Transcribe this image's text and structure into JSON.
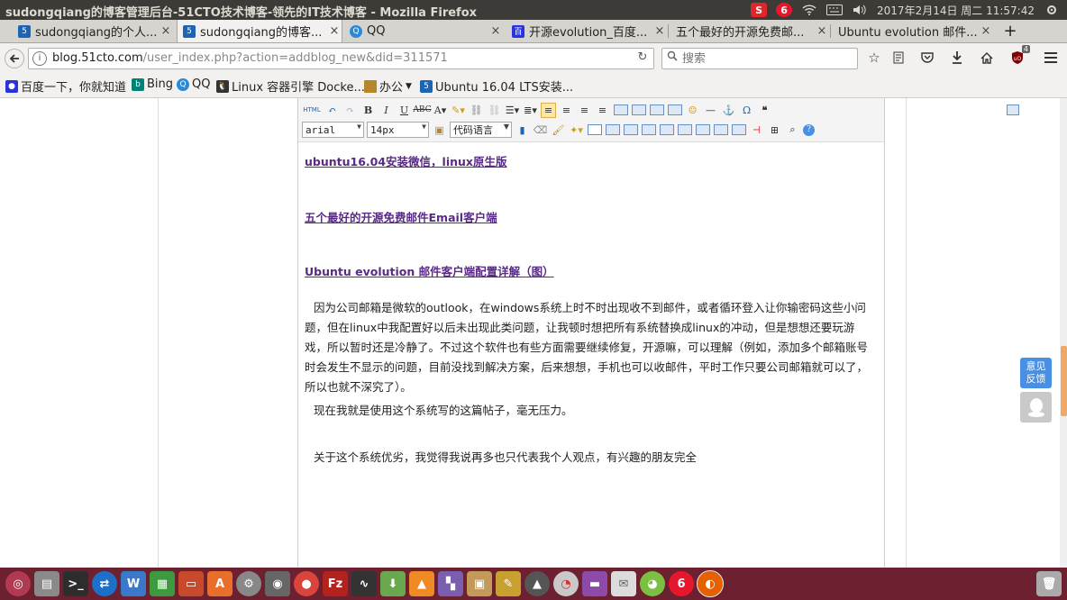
{
  "window": {
    "title": "sudongqiang的博客管理后台-51CTO技术博客-领先的IT技术博客 - Mozilla Firefox"
  },
  "tray": {
    "datetime": "2017年2月14日 周二 11:57:42",
    "ime_label": "S",
    "weibo_label": "6"
  },
  "tabs": [
    {
      "label": "sudongqiang的个人...",
      "close": "×",
      "favicon": "51cto-icon",
      "color": "#1e64b4"
    },
    {
      "label": "sudongqiang的博客...",
      "close": "×",
      "favicon": "51cto-icon",
      "color": "#1e64b4"
    },
    {
      "label": "QQ",
      "close": "×",
      "favicon": "qq-icon",
      "color": "#2b8ad8"
    },
    {
      "label": "开源evolution_百度...",
      "close": "×",
      "favicon": "baidu-icon",
      "color": "#2932e1"
    },
    {
      "label": "五个最好的开源免费邮...",
      "close": "×",
      "favicon": "",
      "color": ""
    },
    {
      "label": "Ubuntu evolution 邮件...",
      "close": "×",
      "favicon": "",
      "color": ""
    }
  ],
  "new_tab": "+",
  "navbar": {
    "url_host": "blog.51cto.com",
    "url_path": "/user_index.php?action=addblog_new&did=311571",
    "search_placeholder": "搜索",
    "badge_count": "4"
  },
  "bookmarks": [
    {
      "label": "百度一下，你就知道",
      "icon": "baidu-paw-icon",
      "color": "#2932e1"
    },
    {
      "label": "Bing",
      "icon": "bing-icon",
      "color": "#008373"
    },
    {
      "label": "QQ",
      "icon": "qq-icon",
      "color": "#2b8ad8"
    },
    {
      "label": "Linux 容器引擎 Docke...",
      "icon": "tux-icon",
      "color": "#333333"
    },
    {
      "label": "办公",
      "icon": "folder-icon",
      "color": "#b8862a"
    },
    {
      "label": "Ubuntu 16.04 LTS安装...",
      "icon": "bookmark-page-icon",
      "color": "#1e64b4"
    }
  ],
  "editor": {
    "toolbar": {
      "html_label": "HTML",
      "font_family": "arial",
      "font_size": "14px",
      "code_language": "代码语言"
    },
    "links": [
      "ubuntu16.04安装微信，linux原生版",
      "五个最好的开源免费邮件Email客户端",
      "Ubuntu evolution 邮件客户端配置详解（图）"
    ],
    "paragraphs": [
      "因为公司邮箱是微软的outlook，在windows系统上时不时出现收不到邮件，或者循环登入让你输密码这些小问题，但在linux中我配置好以后未出现此类问题，让我顿时想把所有系统替换成linux的冲动，但是想想还要玩游戏，所以暂时还是冷静了。不过这个软件也有些方面需要继续修复，开源嘛，可以理解（例如，添加多个邮箱账号时会发生不显示的问题，目前没找到解决方案，后来想想，手机也可以收邮件，平时工作只要公司邮箱就可以了，所以也就不深究了）。",
      "现在我就是使用这个系统写的这篇帖子，毫无压力。",
      "关于这个系统优劣，我觉得我说再多也只代表我个人观点，有兴趣的朋友完全"
    ]
  },
  "side": {
    "feedback": "意见\n反馈"
  },
  "colors": {
    "link": "#5a2a87",
    "panel": "#3c3b37",
    "dock": "#6d2130",
    "feedback": "#4a90e2"
  }
}
